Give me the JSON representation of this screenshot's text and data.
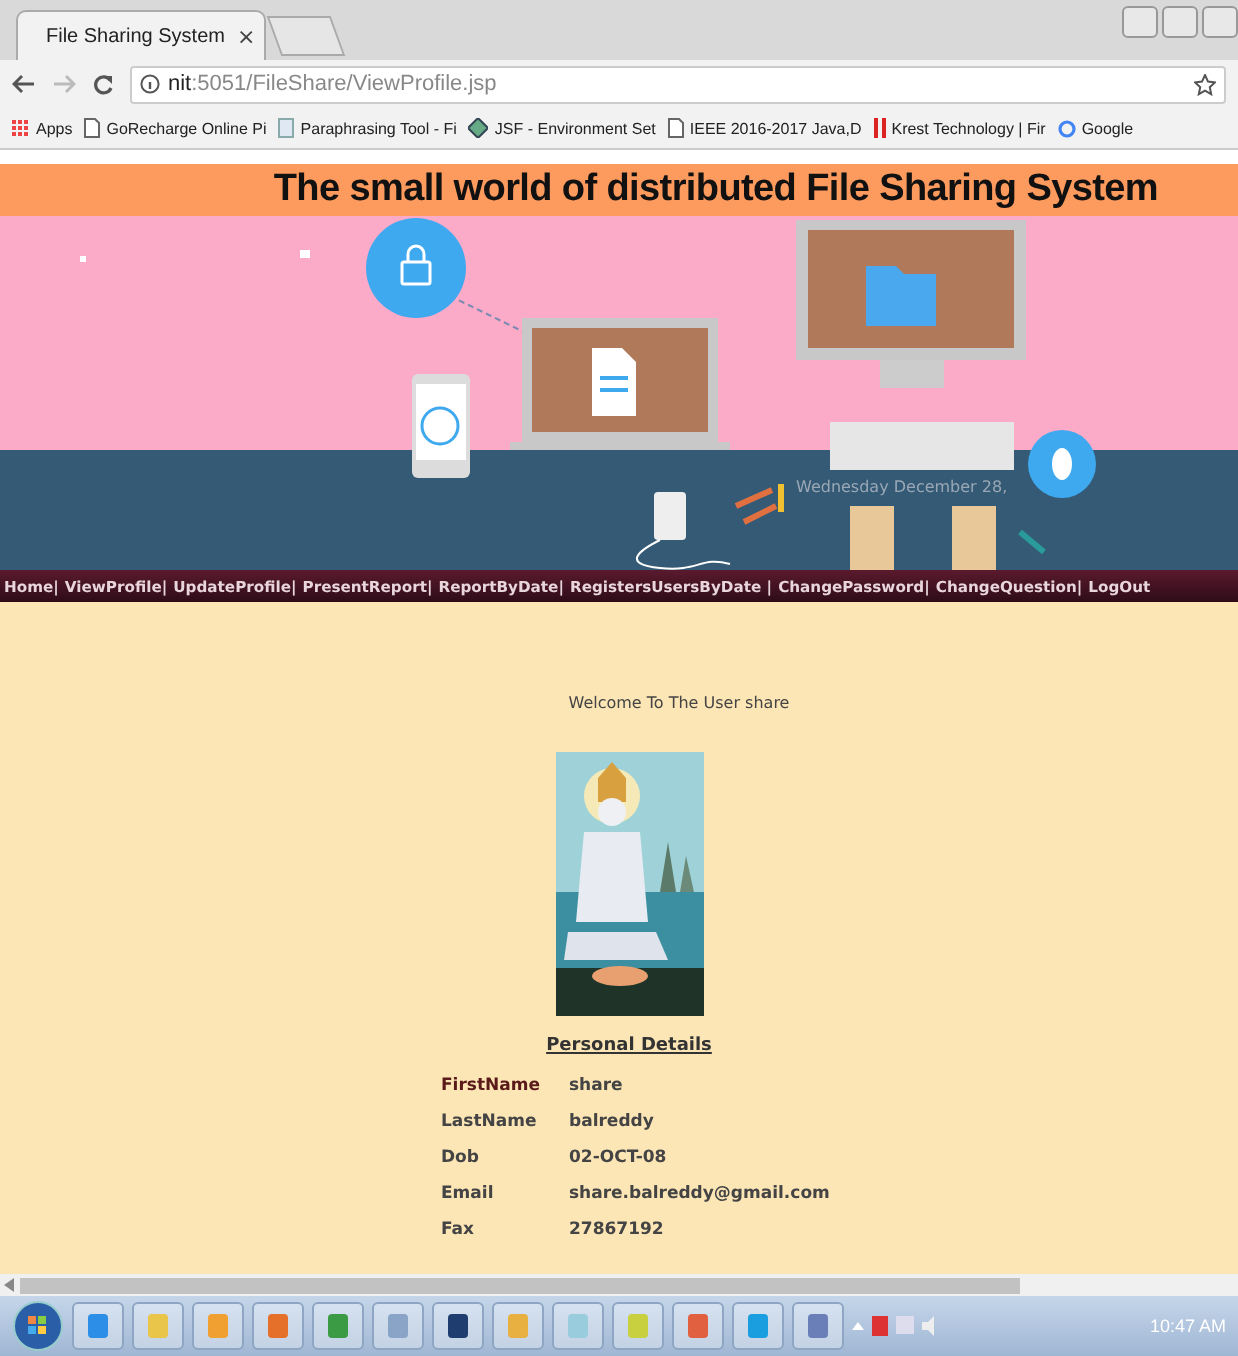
{
  "browser": {
    "tabs": [
      {
        "title": "File Sharing System",
        "close": "×",
        "selected": true
      }
    ],
    "address": {
      "host": "nit",
      "path": ":5051/FileShare/ViewProfile.jsp"
    },
    "bookmarks": [
      {
        "label": "Apps",
        "kind": "apps"
      },
      {
        "label": "GoRecharge Online Pi",
        "kind": "page"
      },
      {
        "label": "Paraphrasing Tool - Fi",
        "kind": "doc"
      },
      {
        "label": "JSF - Environment Set",
        "kind": "diamond"
      },
      {
        "label": "IEEE 2016-2017 Java,D",
        "kind": "page"
      },
      {
        "label": "Krest Technology | Fir",
        "kind": "bars"
      },
      {
        "label": "Google",
        "kind": "google"
      }
    ]
  },
  "header": {
    "title": "The small world of distributed File Sharing System",
    "date": "Wednesday December 28,"
  },
  "nav": [
    "Home|",
    "ViewProfile|",
    "UpdateProfile|",
    "PresentReport|",
    "ReportByDate|",
    "RegistersUsersByDate |",
    "ChangePassword|",
    "ChangeQuestion|",
    "LogOut"
  ],
  "profile": {
    "welcome": "Welcome To The User share",
    "section_title": "Personal Details",
    "fields": [
      {
        "label": "FirstName",
        "value": "share"
      },
      {
        "label": "LastName",
        "value": "balreddy"
      },
      {
        "label": "Dob",
        "value": "02-OCT-08"
      },
      {
        "label": "Email",
        "value": "share.balreddy@gmail.com"
      },
      {
        "label": "Fax",
        "value": "27867192"
      }
    ]
  },
  "taskbar": {
    "clock": "10:47 AM"
  }
}
